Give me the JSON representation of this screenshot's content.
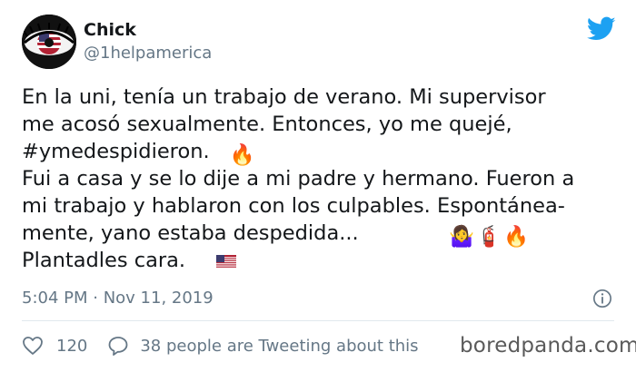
{
  "user": {
    "name": "Chick",
    "handle": "@1helpamerica",
    "avatar_icon": "eye-flag-avatar"
  },
  "brand_icon": "twitter-bird-icon",
  "accent_color": "#1da1f2",
  "tweet": {
    "lines": [
      "En la uni, tenía un trabajo de verano. Mi supervisor",
      "me acosó sexualmente. Entonces, yo me quejé,",
      "#ymedespidieron.",
      "Fui a casa y se lo dije a mi padre y hermano. Fueron a",
      "mi trabajo y hablaron con los culpables. Espontánea-",
      "mente, yano estaba despedida...",
      "Plantadles cara."
    ],
    "emojis": {
      "line3": "🔥",
      "line6": [
        "🤷‍♀️",
        "🧯",
        "🔥"
      ],
      "line7": "us-flag-icon"
    }
  },
  "meta": {
    "timestamp": "5:04 PM · Nov 11, 2019",
    "info_icon": "info-icon"
  },
  "footer": {
    "likes": "120",
    "retweet_text": "38 people are Tweeting about this",
    "watermark": "boredpanda.com"
  }
}
